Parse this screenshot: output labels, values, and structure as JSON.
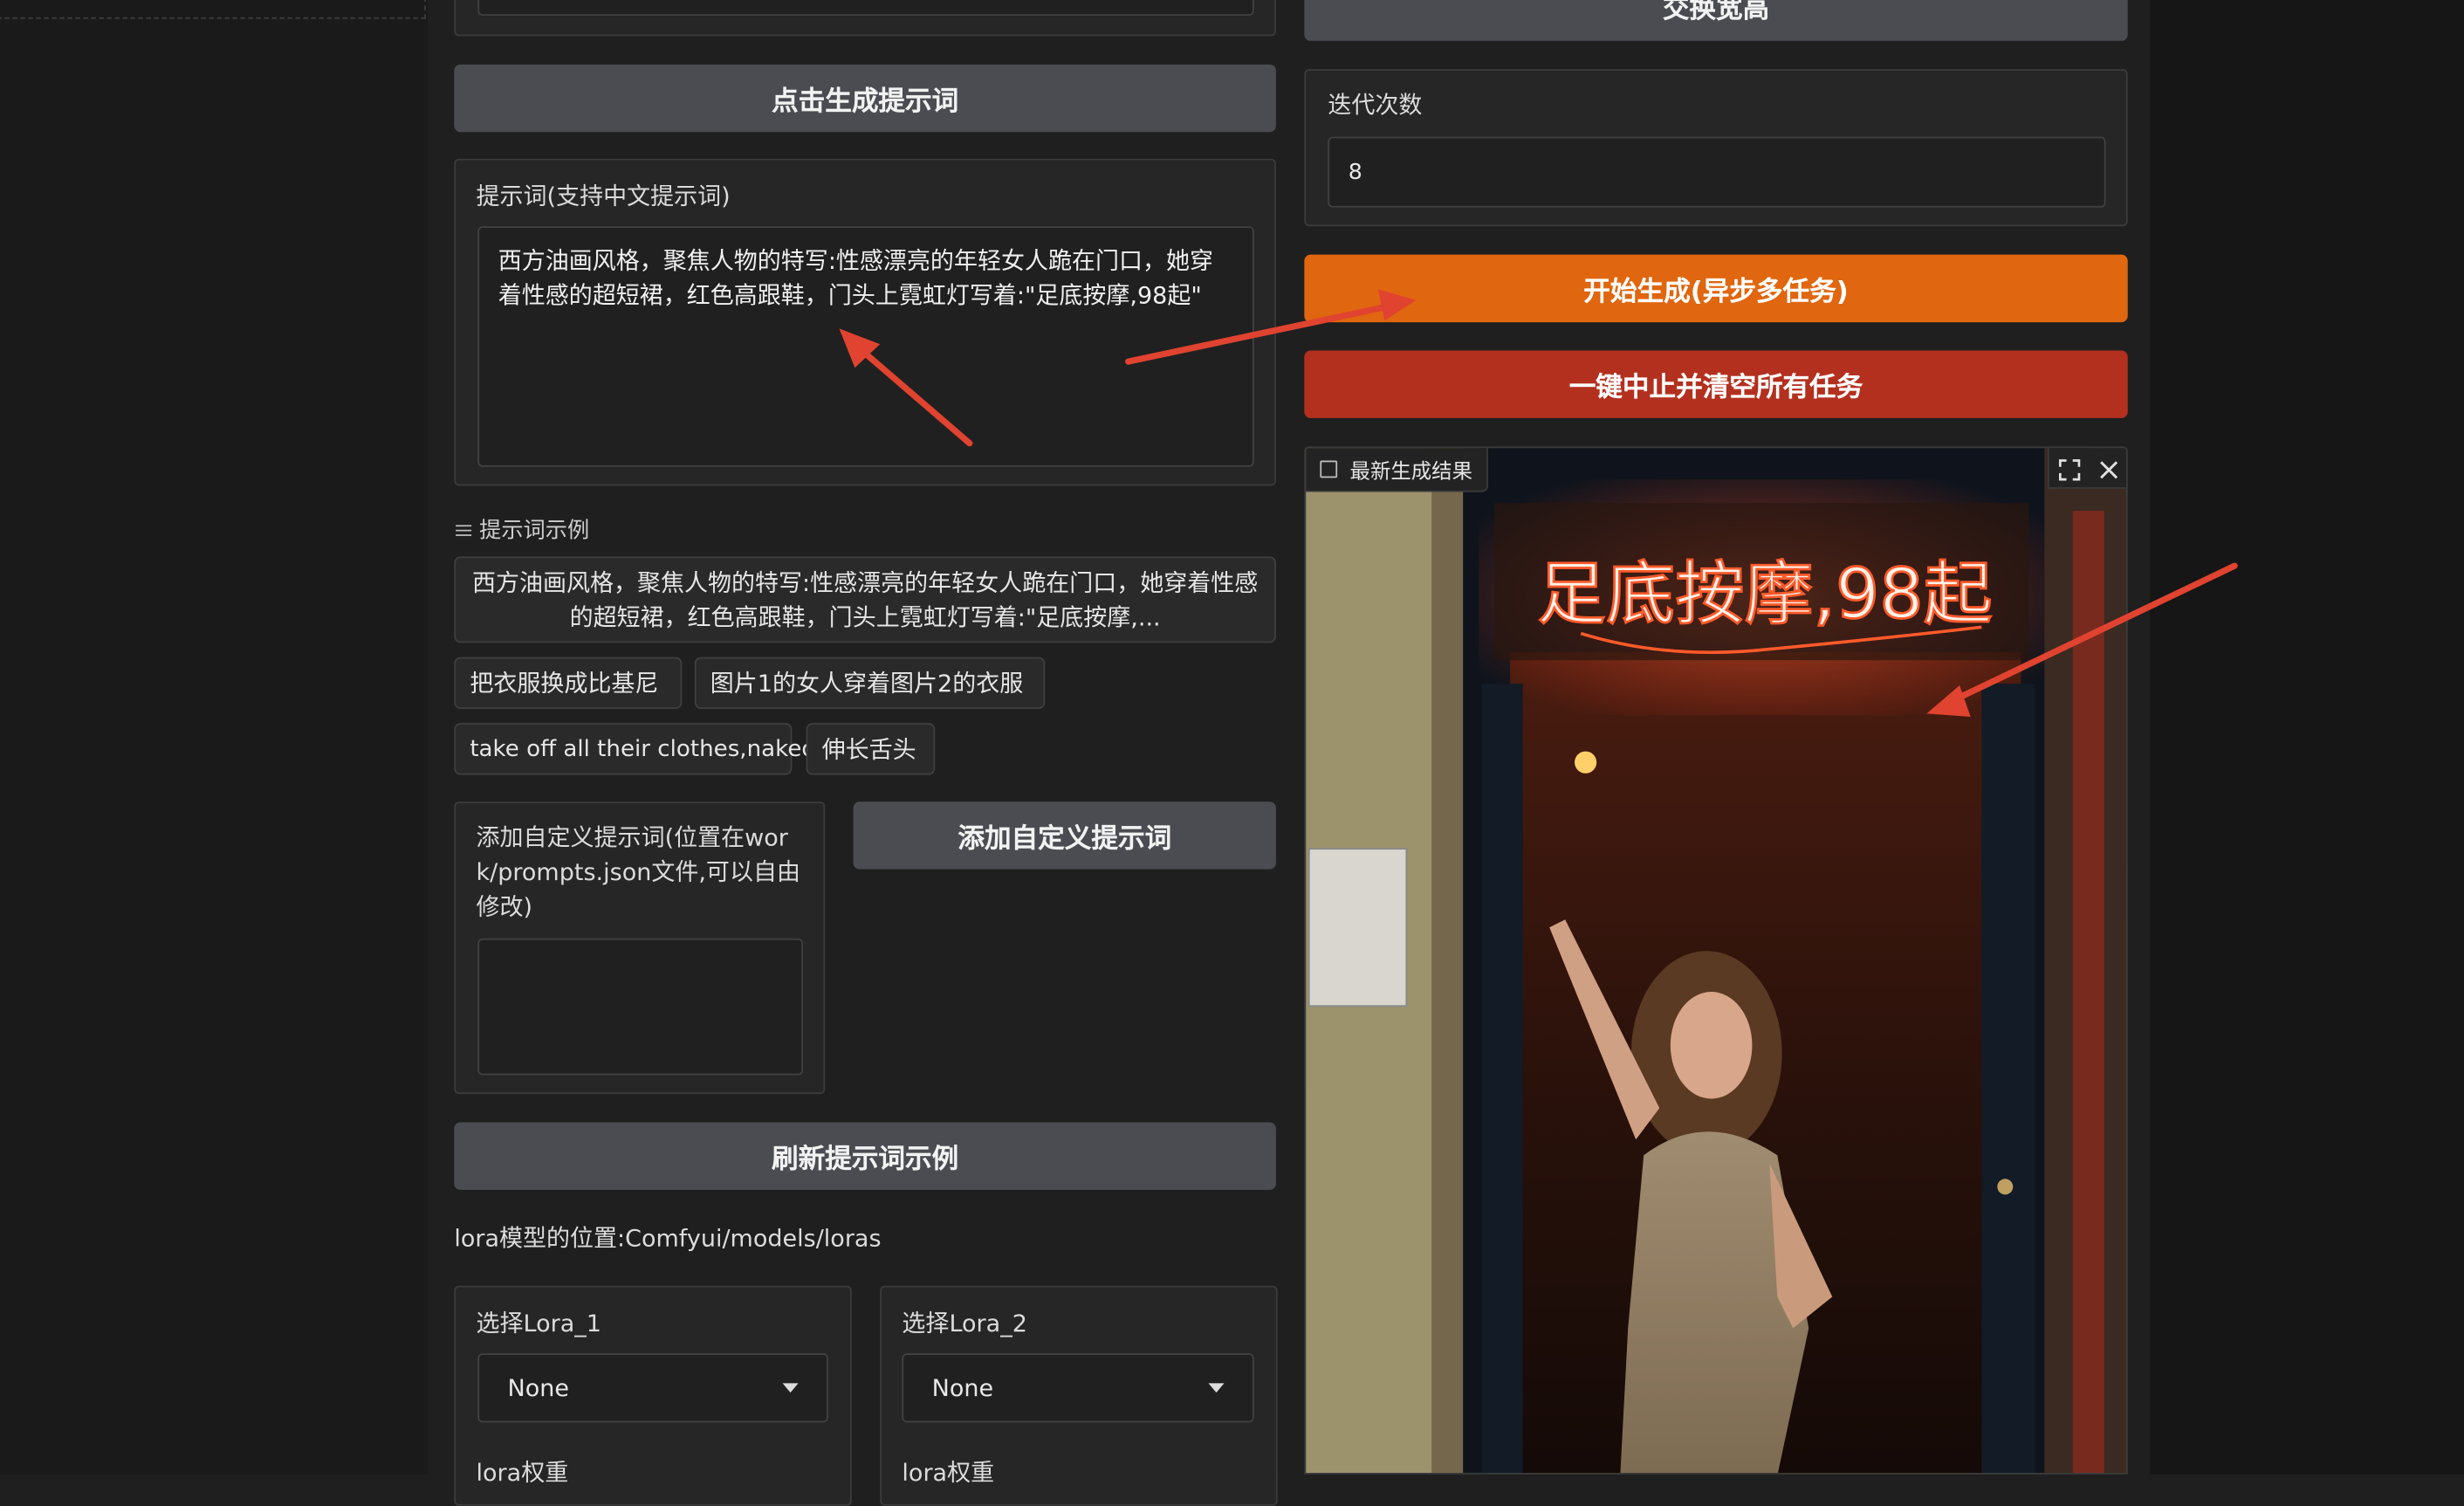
{
  "prompt_panel": {
    "generate_prompt_button": "点击生成提示词",
    "prompt_label": "提示词(支持中文提示词)",
    "prompt_value": "西方油画风格，聚焦人物的特写:性感漂亮的年轻女人跪在门口，她穿着性感的超短裙，红色高跟鞋，门头上霓虹灯写着:\"足底按摩,98起\"",
    "examples_label": "提示词示例",
    "example_main": "西方油画风格，聚焦人物的特写:性感漂亮的年轻女人跪在门口，她穿着性感的超短裙，红色高跟鞋，门头上霓虹灯写着:\"足底按摩,...",
    "chips": [
      "把衣服换成比基尼",
      "图片1的女人穿着图片2的衣服",
      "take off all their clothes,naked",
      "伸长舌头"
    ],
    "custom_prompt_label": "添加自定义提示词(位置在work/prompts.json文件,可以自由修改)",
    "custom_prompt_value": "",
    "add_custom_button": "添加自定义提示词",
    "refresh_examples_button": "刷新提示词示例",
    "lora_location": "lora模型的位置:Comfyui/models/loras",
    "lora1_label": "选择Lora_1",
    "lora1_value": "None",
    "lora2_label": "选择Lora_2",
    "lora2_value": "None",
    "lora_weight_label_1": "lora权重",
    "lora_weight_label_2": "lora权重"
  },
  "right_panel": {
    "swap_button": "交换宽高",
    "iterations_label": "迭代次数",
    "iterations_value": "8",
    "start_button": "开始生成(异步多任务)",
    "stop_button": "一键中止并清空所有任务",
    "result_label": "最新生成结果",
    "neon_sign_text": "足底按摩,98起"
  },
  "colors": {
    "orange": "#e0660f",
    "red": "#b3301f",
    "button_gray": "#4b4c52",
    "annotation_arrow": "#e0432f"
  },
  "icons": [
    "list-icon",
    "image-icon",
    "fullscreen-icon",
    "close-icon",
    "chevron-down-icon"
  ]
}
